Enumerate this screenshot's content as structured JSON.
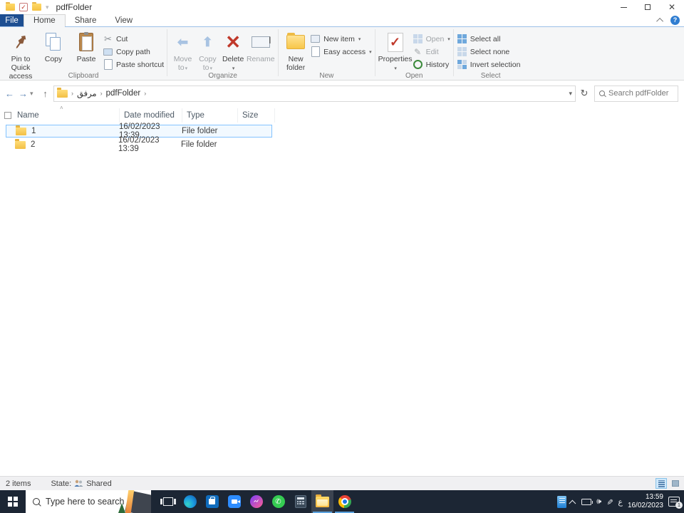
{
  "window": {
    "title": "pdfFolder"
  },
  "tabs": {
    "file": "File",
    "home": "Home",
    "share": "Share",
    "view": "View"
  },
  "ribbon": {
    "clipboard": {
      "label": "Clipboard",
      "pin": "Pin to Quick access",
      "copy": "Copy",
      "paste": "Paste",
      "cut": "Cut",
      "copy_path": "Copy path",
      "paste_shortcut": "Paste shortcut"
    },
    "organize": {
      "label": "Organize",
      "move_to": "Move to",
      "copy_to": "Copy to",
      "delete": "Delete",
      "rename": "Rename"
    },
    "new_group": {
      "label": "New",
      "new_folder": "New folder",
      "new_item": "New item",
      "easy_access": "Easy access"
    },
    "open_group": {
      "label": "Open",
      "properties": "Properties",
      "open": "Open",
      "edit": "Edit",
      "history": "History"
    },
    "select_group": {
      "label": "Select",
      "select_all": "Select all",
      "select_none": "Select none",
      "invert": "Invert selection"
    }
  },
  "address": {
    "breadcrumb": {
      "root": "مرفق",
      "current": "pdfFolder"
    },
    "search_placeholder": "Search pdfFolder"
  },
  "list": {
    "columns": {
      "name": "Name",
      "date": "Date modified",
      "type": "Type",
      "size": "Size"
    },
    "rows": [
      {
        "name": "1",
        "date": "16/02/2023 13:39",
        "type": "File folder",
        "size": ""
      },
      {
        "name": "2",
        "date": "16/02/2023 13:39",
        "type": "File folder",
        "size": ""
      }
    ]
  },
  "status": {
    "items": "2 items",
    "state_label": "State:",
    "state_value": "Shared"
  },
  "taskbar": {
    "search_placeholder": "Type here to search",
    "language": "ع",
    "clock": {
      "time": "13:59",
      "date": "16/02/2023"
    },
    "notification_count": "1"
  },
  "colors": {
    "accent": "#1d4e91",
    "selection_border": "#84c3ff",
    "taskbar_bg": "#1c2634",
    "active_underline": "#5ba3e0"
  }
}
